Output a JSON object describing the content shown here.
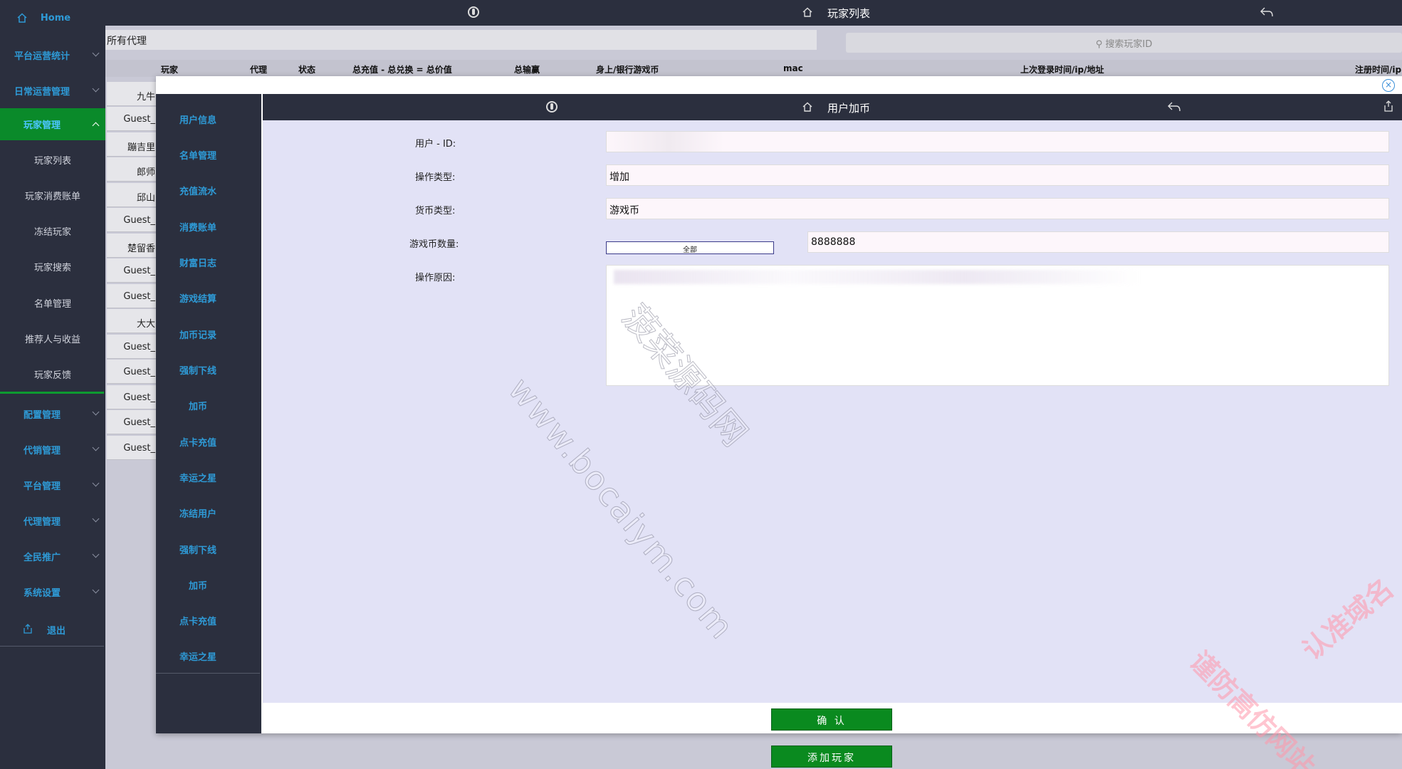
{
  "sidebar": {
    "home": "Home",
    "groups": [
      {
        "label": "平台运营统计"
      },
      {
        "label": "日常运营管理"
      },
      {
        "label": "玩家管理"
      }
    ],
    "sub_items": [
      "玩家列表",
      "玩家消费账单",
      "冻结玩家",
      "玩家搜索",
      "名单管理",
      "推荐人与收益",
      "玩家反馈"
    ],
    "groups2": [
      "配置管理",
      "代销管理",
      "平台管理",
      "代理管理",
      "全民推广",
      "系统设置"
    ],
    "logout": "退出"
  },
  "topbar": {
    "title": "玩家列表"
  },
  "list": {
    "agent_filter": "所有代理",
    "search_placeholder": "搜索玩家ID",
    "columns": [
      "玩家",
      "代理",
      "状态",
      "总充值 - 总兑换 = 总价值",
      "总输赢",
      "身上/银行游戏币",
      "mac",
      "上次登录时间/ip/地址",
      "注册时间/ip"
    ],
    "rows": [
      "九牛",
      "Guest_",
      "蹦吉里",
      "郎师",
      "邱山",
      "Guest_",
      "楚留香",
      "Guest_",
      "Guest_",
      "大大",
      "Guest_",
      "Guest_",
      "Guest_",
      "Guest_",
      "Guest_"
    ]
  },
  "modal": {
    "title": "用户加币",
    "side_items": [
      "用户信息",
      "名单管理",
      "充值流水",
      "消费账单",
      "财富日志",
      "游戏结算",
      "加币记录",
      "强制下线",
      "加币",
      "点卡充值",
      "幸运之星",
      "冻结用户",
      "强制下线",
      "加币",
      "点卡充值",
      "幸运之星"
    ],
    "form": {
      "user_id_label": "用户 - ID:",
      "op_type_label": "操作类型:",
      "op_type_value": "增加",
      "currency_label": "货币类型:",
      "currency_value": "游戏币",
      "amount_label": "游戏币数量:",
      "all_button": "全部",
      "amount_value": "8888888",
      "reason_label": "操作原因:"
    },
    "confirm_button": "确 认"
  },
  "add_player_button": "添加玩家",
  "watermarks": {
    "center_url": "www.bocaiym.com",
    "center_cn": "菠菜源码网",
    "corner_1": "认准域名",
    "corner_2": "谨防高仿网站"
  },
  "colors": {
    "sidebar_bg": "#2b2f3e",
    "accent_blue": "#2e9ad6",
    "active_green": "#0a8a2a",
    "modal_body": "#e2e2f6"
  }
}
